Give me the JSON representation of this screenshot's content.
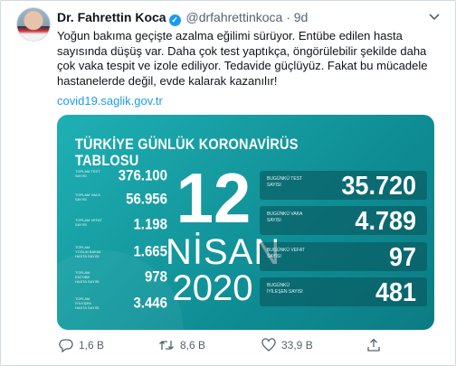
{
  "tweet": {
    "author_name": "Dr. Fahrettin Koca",
    "handle": "@drfahrettinkoca",
    "separator": "·",
    "time": "9d",
    "text": "Yoğun bakıma geçişte azalma eğilimi sürüyor. Entübe edilen hasta sayısında düşüş var. Daha çok test yaptıkça, öngörülebilir şekilde daha çok vaka tespit ve izole ediliyor. Tedavide güçlüyüz. Fakat bu mücadele hastanelerde değil, evde kalarak kazanılır!",
    "link": "covid19.saglik.gov.tr"
  },
  "card": {
    "title": "TÜRKİYE GÜNLÜK KORONAVİRÜS TABLOSU",
    "date_day": "12",
    "date_month": "NİSAN",
    "date_year": "2020",
    "left_stats": [
      {
        "label": "TOPLAM TEST SAYISI",
        "value": "376.100"
      },
      {
        "label": "TOPLAM VAKA SAYISI",
        "value": "56.956"
      },
      {
        "label": "TOPLAM VEFAT SAYISI",
        "value": "1.198"
      },
      {
        "label": "TOPLAM YOĞUN BAKIM HASTA SAYISI",
        "value": "1.665"
      },
      {
        "label": "TOPLAM ENTÜBE HASTA SAYISI",
        "value": "978"
      },
      {
        "label": "TOPLAM İYİLEŞEN HASTA SAYISI",
        "value": "3.446"
      }
    ],
    "right_stats": [
      {
        "label": "BUGÜNKÜ TEST SAYISI",
        "value": "35.720"
      },
      {
        "label": "BUGÜNKÜ VAKA SAYISI",
        "value": "4.789"
      },
      {
        "label": "BUGÜNKÜ VEFAT SAYISI",
        "value": "97"
      },
      {
        "label": "BUGÜNKÜ İYİLEŞEN SAYISI",
        "value": "481"
      }
    ]
  },
  "actions": {
    "reply_count": "1,6 B",
    "retweet_count": "8,6 B",
    "like_count": "33,9 B"
  },
  "icons": {
    "verified": "verified-badge-icon",
    "more": "chevron-down-icon",
    "reply": "reply-icon",
    "retweet": "retweet-icon",
    "like": "heart-icon",
    "share": "share-icon"
  },
  "colors": {
    "accent": "#1d9bf0",
    "card_teal": "#129ba0",
    "text_secondary": "#536471"
  }
}
